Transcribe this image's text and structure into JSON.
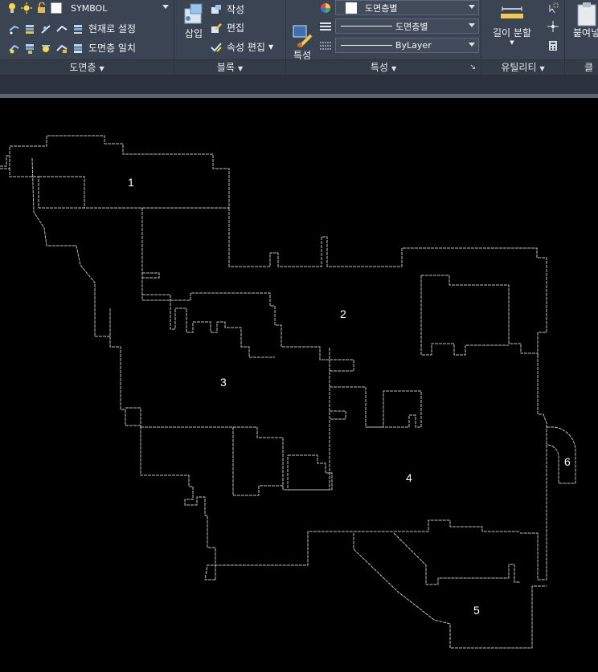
{
  "ribbon": {
    "layers": {
      "title": "도면층",
      "current_layer": "SYMBOL",
      "set_current_label": "현재로 설정",
      "match_layer_label": "도면층 일치"
    },
    "block": {
      "title": "블록",
      "insert_label": "삽입",
      "create_label": "작성",
      "edit_label": "편집",
      "edit_attributes_label": "속성 편집"
    },
    "properties": {
      "title": "특성",
      "match_properties_label": "특성\n일치",
      "color_value": "도면층별",
      "linetype_value": "도면층별",
      "lineweight_value": "ByLayer"
    },
    "utilities": {
      "title": "유틸리티",
      "measure_label": "길이 분할"
    },
    "clipboard": {
      "title": "클",
      "paste_label": "붙여넣"
    }
  },
  "canvas": {
    "room_labels": [
      "1",
      "2",
      "3",
      "4",
      "5",
      "6"
    ]
  },
  "colors": {
    "ribbon_bg": "#3b4453",
    "panel_title_bg": "#343c48",
    "canvas_bg": "#000000",
    "drawing_line": "#bfbfbf"
  }
}
